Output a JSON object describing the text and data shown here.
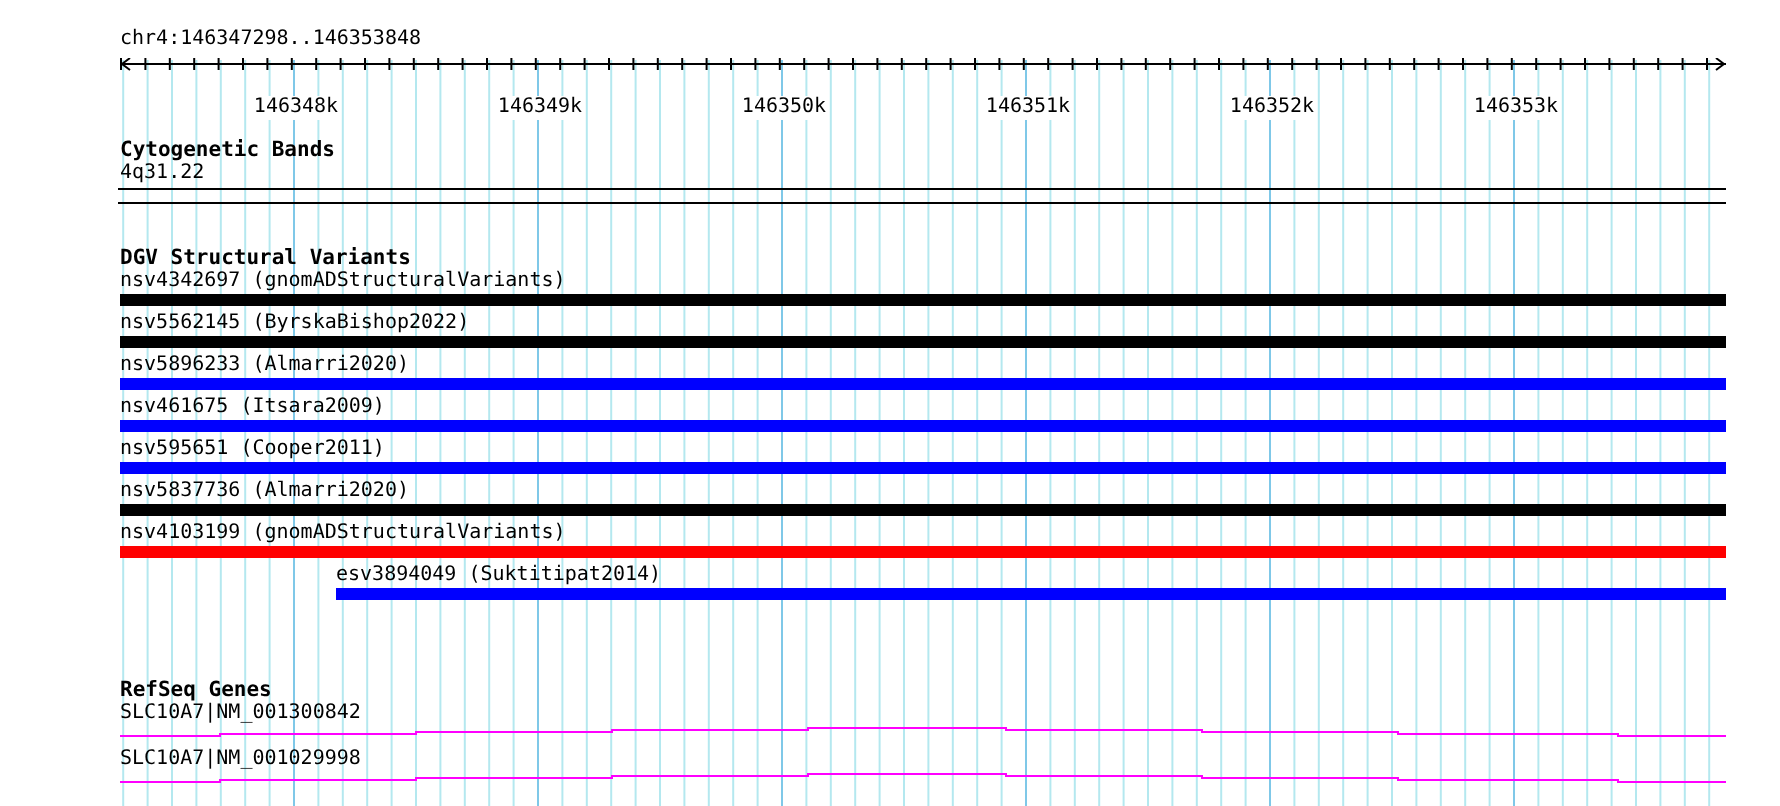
{
  "location": "chr4:146347298..146353848",
  "axis_ticks": [
    "146348k",
    "146349k",
    "146350k",
    "146351k",
    "146352k",
    "146353k"
  ],
  "cytogenetic_bands": {
    "title": "Cytogenetic Bands",
    "band": "4q31.22"
  },
  "dgv": {
    "title": "DGV Structural Variants",
    "variants": [
      {
        "label": "nsv4342697 (gnomADStructuralVariants)",
        "color": "#000000",
        "kind": "full"
      },
      {
        "label": "nsv5562145 (ByrskaBishop2022)",
        "color": "#000000",
        "kind": "full"
      },
      {
        "label": "nsv5896233 (Almarri2020)",
        "color": "#0000ff",
        "kind": "full"
      },
      {
        "label": "nsv461675 (Itsara2009)",
        "color": "#0000ff",
        "kind": "full"
      },
      {
        "label": "nsv595651 (Cooper2011)",
        "color": "#0000ff",
        "kind": "full"
      },
      {
        "label": "nsv5837736 (Almarri2020)",
        "color": "#000000",
        "kind": "full"
      },
      {
        "label": "nsv4103199 (gnomADStructuralVariants)",
        "color": "#ff0000",
        "kind": "full"
      },
      {
        "label": "esv3894049 (Suktitipat2014)",
        "color": "#0000ff",
        "kind": "partial"
      }
    ]
  },
  "refseq": {
    "title": "RefSeq Genes",
    "genes": [
      {
        "label": "SLC10A7|NM_001300842"
      },
      {
        "label": "SLC10A7|NM_001029998"
      }
    ]
  }
}
